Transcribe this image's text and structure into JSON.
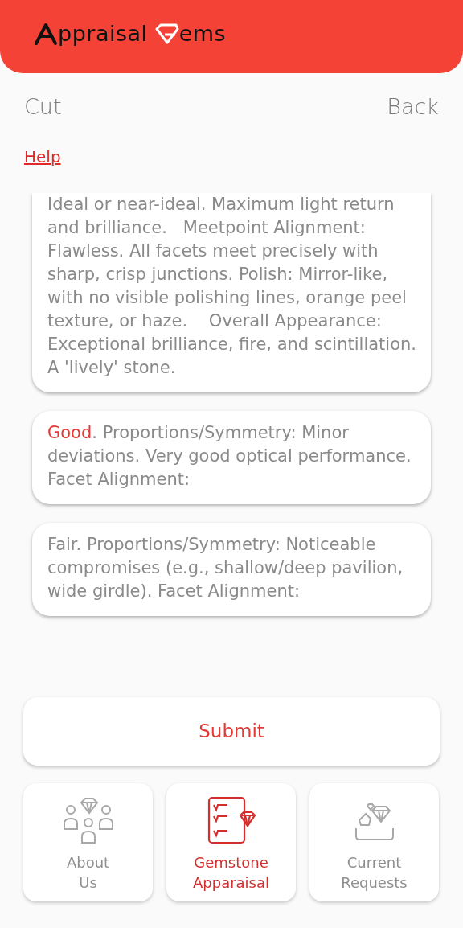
{
  "app_title": {
    "before": "ppraisal ",
    "after": "ems"
  },
  "section_title": "Cut",
  "back_link": "Back",
  "help_link": "Help",
  "options": [
    {
      "text": "Ideal or near-ideal. Maximum light return and brilliance.   Meetpoint Alignment: Flawless. All facets meet precisely with sharp, crisp junctions. Polish: Mirror-like, with no visible polishing lines, orange peel texture, or haze.    Overall Appearance: Exceptional brilliance, fire, and scintillation. A 'lively' stone.",
      "selected": false
    },
    {
      "grade": "Good",
      "text": ". Proportions/Symmetry: Minor deviations. Very good optical performance.    Facet Alignment:",
      "selected": true
    },
    {
      "grade": "Fair",
      "text": ". Proportions/Symmetry: Noticeable compromises (e.g., shallow/deep pavilion, wide girdle). Facet Alignment:",
      "selected": false
    }
  ],
  "submit_button": "Submit",
  "nav": [
    {
      "kind": "about",
      "label": "About\nUs",
      "selected": false
    },
    {
      "kind": "appraisal",
      "label": "Gemstone\nApparaisal",
      "selected": true
    },
    {
      "kind": "requests",
      "label": "Current\nRequests",
      "selected": false
    }
  ]
}
